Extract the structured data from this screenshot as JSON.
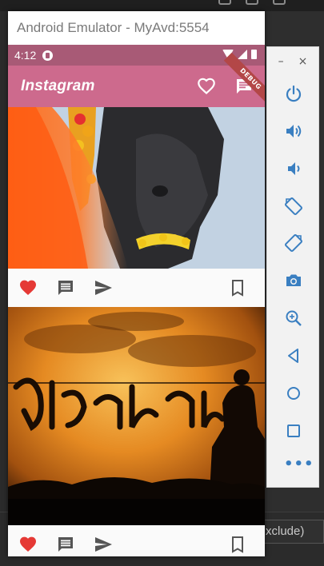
{
  "emulator": {
    "window_title": "Android Emulator - MyAvd:5554",
    "toolbar": {
      "minimize_symbol": "–",
      "close_symbol": "×",
      "more_symbol": "•••"
    }
  },
  "status_bar": {
    "time": "4:12",
    "debug_banner": "DEBUG"
  },
  "app_bar": {
    "title": "Instagram"
  },
  "ide": {
    "exclude_text": "xclude)"
  },
  "colors": {
    "status_bar": "#a85a76",
    "app_bar": "#cd6a8d",
    "like_red": "#e53935",
    "icon_grey": "#555555",
    "toolbar_blue": "#3a7fc1"
  },
  "icons": [
    "favorite-border-icon",
    "chat-icon",
    "favorite-icon",
    "comment-icon",
    "send-icon",
    "bookmark-border-icon",
    "power-icon",
    "volume-up-icon",
    "volume-down-icon",
    "rotate-left-icon",
    "rotate-right-icon",
    "camera-icon",
    "zoom-in-icon",
    "back-icon",
    "home-icon",
    "overview-icon",
    "more-icon"
  ]
}
